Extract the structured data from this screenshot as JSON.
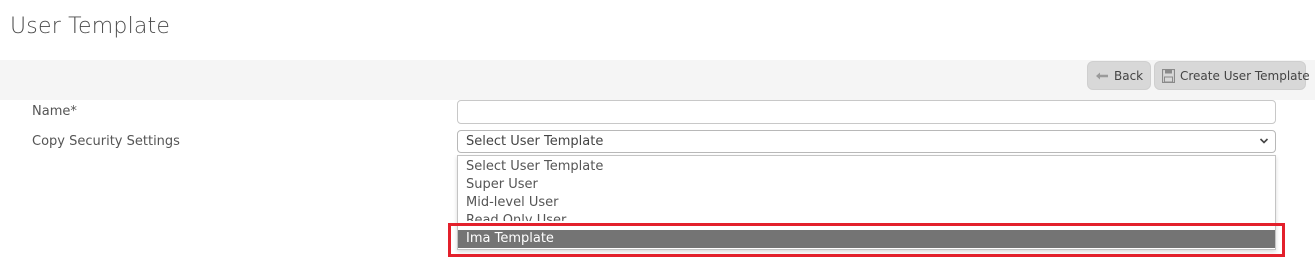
{
  "page": {
    "title": "User Template"
  },
  "toolbar": {
    "back_label": "Back",
    "back_icon": "arrow-left-icon",
    "create_label": "Create User Template",
    "create_icon": "save-icon"
  },
  "form": {
    "name_label": "Name*",
    "name_value": "",
    "copy_label": "Copy Security Settings",
    "copy_selected": "Select User Template",
    "copy_options": [
      "Select User Template",
      "Super User",
      "Mid-level User",
      "Read Only User",
      "Ima Template"
    ],
    "highlighted_option": "Ima Template"
  },
  "colors": {
    "highlight_border": "#e3202b",
    "selected_option_bg": "#747474",
    "button_bg": "#d8d8d8",
    "toolbar_bg": "#f5f5f5"
  }
}
